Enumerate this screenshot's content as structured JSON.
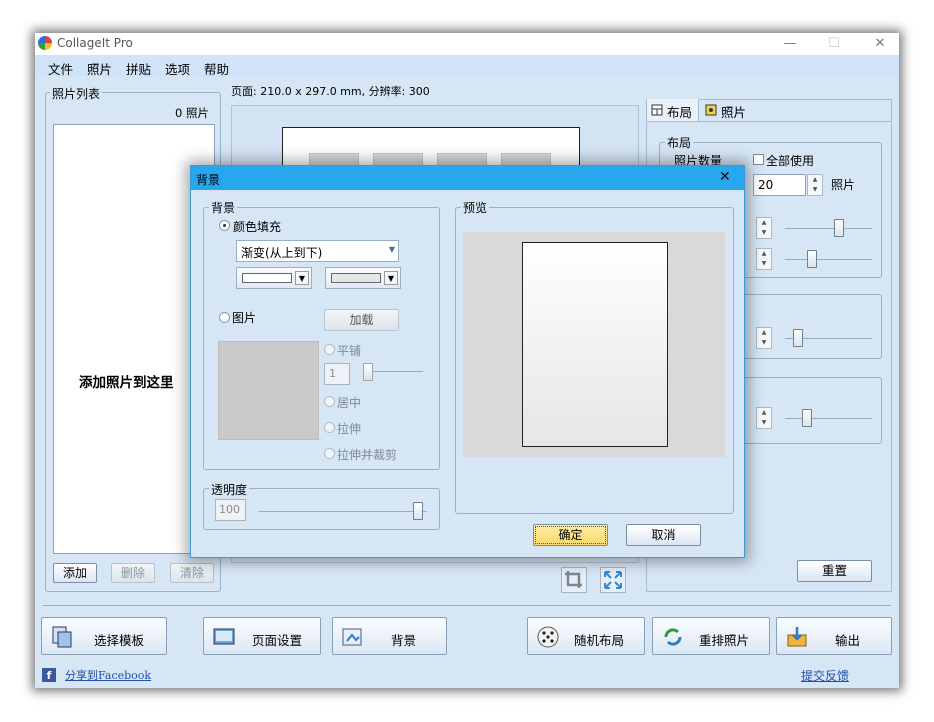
{
  "window": {
    "title": "CollageIt Pro",
    "controls": {
      "minimize": "—",
      "maximize": "☐",
      "close": "✕"
    }
  },
  "menu": [
    "文件",
    "照片",
    "拼贴",
    "选项",
    "帮助"
  ],
  "photo_list": {
    "title": "照片列表",
    "count": "0 照片",
    "placeholder": "添加照片到这里",
    "add_button": "添加",
    "delete_button": "删除",
    "clear_button": "清除"
  },
  "page_info": "页面: 210.0 x 297.0 mm, 分辨率: 300",
  "right_panel": {
    "tab_layout": "布局",
    "tab_photo": "照片",
    "layout_group": "布局",
    "photo_count_label": "照片数量",
    "use_all_label": "全部使用",
    "photo_count_value": "20",
    "photo_count_unit": "照片",
    "reset_button": "重置"
  },
  "bottom_buttons": {
    "template": "选择模板",
    "page_setup": "页面设置",
    "background": "背景",
    "random_layout": "随机布局",
    "shuffle": "重排照片",
    "export": "输出"
  },
  "footer": {
    "share": "分享到Facebook",
    "feedback": "提交反馈"
  },
  "dialog": {
    "title": "背景",
    "close": "✕",
    "bg_group": "背景",
    "color_fill": "颜色填充",
    "gradient_select": "渐变(从上到下)",
    "image_option": "图片",
    "load_button": "加载",
    "tile": "平铺",
    "tile_value": "1",
    "center": "居中",
    "stretch": "拉伸",
    "stretch_crop": "拉伸并裁剪",
    "opacity_group": "透明度",
    "opacity_value": "100",
    "preview_group": "预览",
    "ok_button": "确定",
    "cancel_button": "取消"
  },
  "colors": {
    "window_bg": "#d6e6f5",
    "dialog_title": "#28a7ee",
    "ok_button": "#fde48a"
  }
}
